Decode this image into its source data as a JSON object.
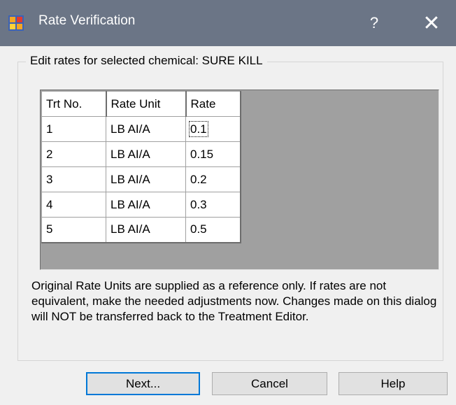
{
  "window": {
    "title": "Rate Verification",
    "help_label": "?",
    "close_label": "✕",
    "app_icon": "form-app-icon"
  },
  "group": {
    "legend": "Edit rates for selected chemical: SURE KILL"
  },
  "grid": {
    "columns": [
      "Trt No.",
      "Rate Unit",
      "Rate"
    ],
    "rows": [
      {
        "trt": "1",
        "unit": "LB AI/A",
        "rate": "0.1"
      },
      {
        "trt": "2",
        "unit": "LB AI/A",
        "rate": "0.15"
      },
      {
        "trt": "3",
        "unit": "LB AI/A",
        "rate": "0.2"
      },
      {
        "trt": "4",
        "unit": "LB AI/A",
        "rate": "0.3"
      },
      {
        "trt": "5",
        "unit": "LB AI/A",
        "rate": "0.5"
      }
    ],
    "selected_row": 0
  },
  "note": "Original Rate Units are supplied as a reference only.  If rates are not equivalent, make the needed adjustments now.  Changes made on this dialog will NOT be transferred back to the Treatment Editor.",
  "buttons": {
    "next": "Next...",
    "cancel": "Cancel",
    "help": "Help"
  },
  "colors": {
    "titlebar": "#6b7586",
    "focus_border": "#0078d7",
    "grid_background": "#a0a0a0"
  }
}
